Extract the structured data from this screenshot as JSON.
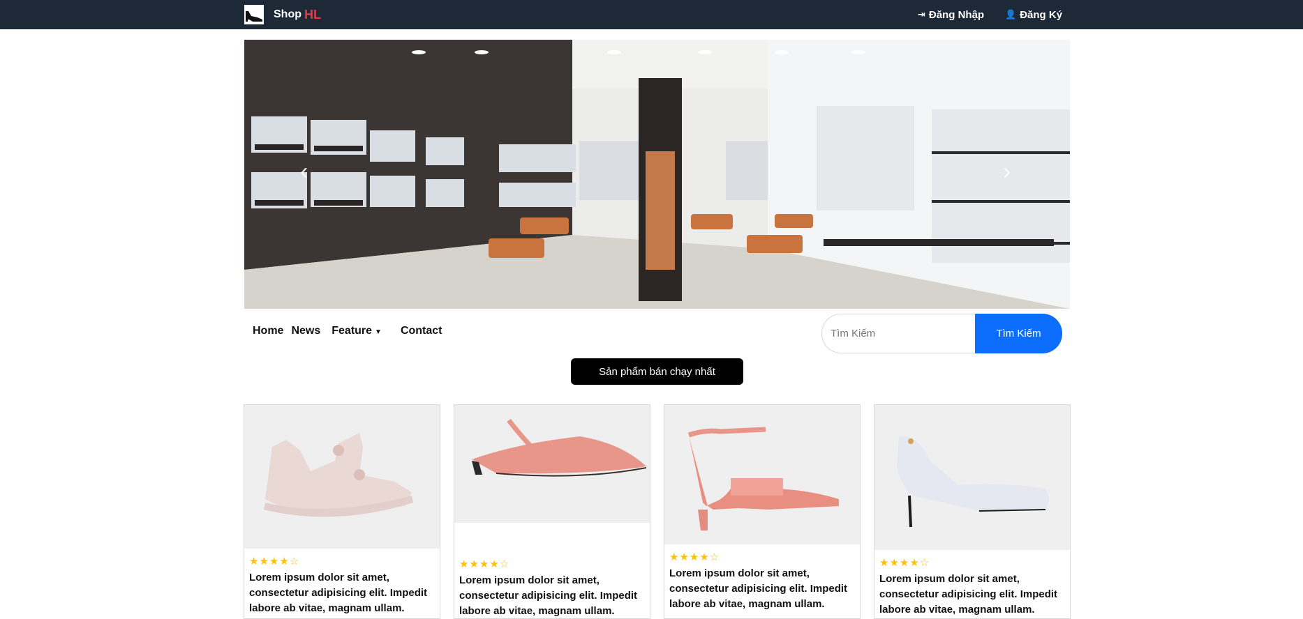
{
  "header": {
    "brand_name": "Shop",
    "brand_accent": "HL",
    "login_label": "Đăng Nhập",
    "register_label": "Đăng Ký"
  },
  "nav": {
    "items": [
      "Home",
      "News",
      "Feature",
      "Contact"
    ]
  },
  "search": {
    "placeholder": "Tìm Kiếm",
    "button_label": "Tìm Kiếm"
  },
  "section": {
    "best_sellers_label": "Sản phẩm bán chạy nhất"
  },
  "products": [
    {
      "rating": 4,
      "description": "Lorem ipsum dolor sit amet, consectetur adipisicing elit. Impedit labore ab vitae, magnam ullam."
    },
    {
      "rating": 4,
      "description": "Lorem ipsum dolor sit amet, consectetur adipisicing elit. Impedit labore ab vitae, magnam ullam."
    },
    {
      "rating": 4,
      "description": "Lorem ipsum dolor sit amet, consectetur adipisicing elit. Impedit labore ab vitae, magnam ullam."
    },
    {
      "rating": 4,
      "description": "Lorem ipsum dolor sit amet, consectetur adipisicing elit. Impedit labore ab vitae, magnam ullam."
    }
  ],
  "colors": {
    "navbar": "#1e2938",
    "brand_accent": "#e63946",
    "primary": "#0d6efd",
    "star": "#ffc107"
  },
  "icons": {
    "login": "sign-in-icon",
    "register": "user-plus-icon",
    "dropdown": "caret-down-icon",
    "carousel_prev": "chevron-left-icon",
    "carousel_next": "chevron-right-icon",
    "star": "star-icon"
  }
}
